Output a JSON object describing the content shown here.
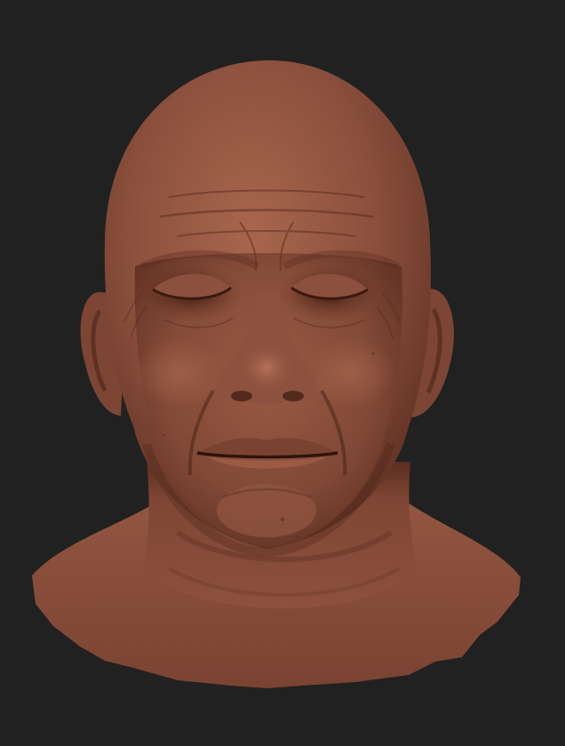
{
  "scene": {
    "subject": "clay-sculpt-head-bust",
    "background_color": "#212121",
    "material_colors": {
      "base": "#8a4f3c",
      "highlight": "#a8664d",
      "midtone": "#7a4433",
      "shadow": "#4a2418",
      "deep_shadow": "#2e130c"
    }
  }
}
